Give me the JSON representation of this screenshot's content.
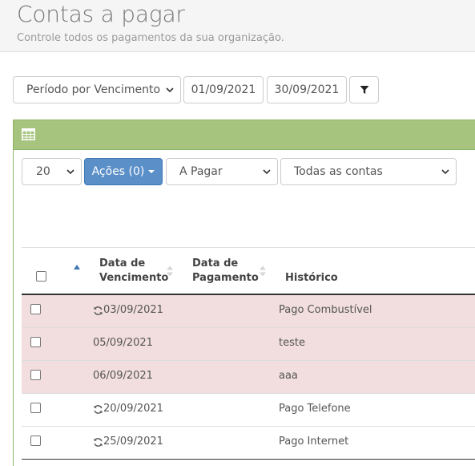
{
  "header": {
    "title": "Contas a pagar",
    "subtitle": "Controle todos os pagamentos da sua organização."
  },
  "filters": {
    "period_select": "Período por Vencimento",
    "date_start": "01/09/2021",
    "date_end": "30/09/2021",
    "filter_icon": "filter-icon"
  },
  "panel": {
    "heading_icon": "table-icon",
    "page_size": "20",
    "actions_label": "Ações (0)",
    "status_select": "A Pagar",
    "accounts_select": "Todas as contas"
  },
  "table": {
    "columns": {
      "due_date_line1": "Data de",
      "due_date_line2": "Vencimento",
      "pay_date_line1": "Data de",
      "pay_date_line2": "Pagamento",
      "history": "Histórico"
    },
    "rows": [
      {
        "due_date": "03/09/2021",
        "recurring": true,
        "history": "Pago Combustível",
        "overdue": true
      },
      {
        "due_date": "05/09/2021",
        "recurring": false,
        "history": "teste",
        "overdue": true
      },
      {
        "due_date": "06/09/2021",
        "recurring": false,
        "history": "aaa",
        "overdue": true
      },
      {
        "due_date": "20/09/2021",
        "recurring": true,
        "history": "Pago Telefone",
        "overdue": false
      },
      {
        "due_date": "25/09/2021",
        "recurring": true,
        "history": "Pago Internet",
        "overdue": false
      }
    ]
  },
  "colors": {
    "panel_heading": "#a6c47d",
    "actions_button": "#5b8fc8",
    "overdue_row": "#f2dede",
    "sort_active": "#3f77b6"
  }
}
